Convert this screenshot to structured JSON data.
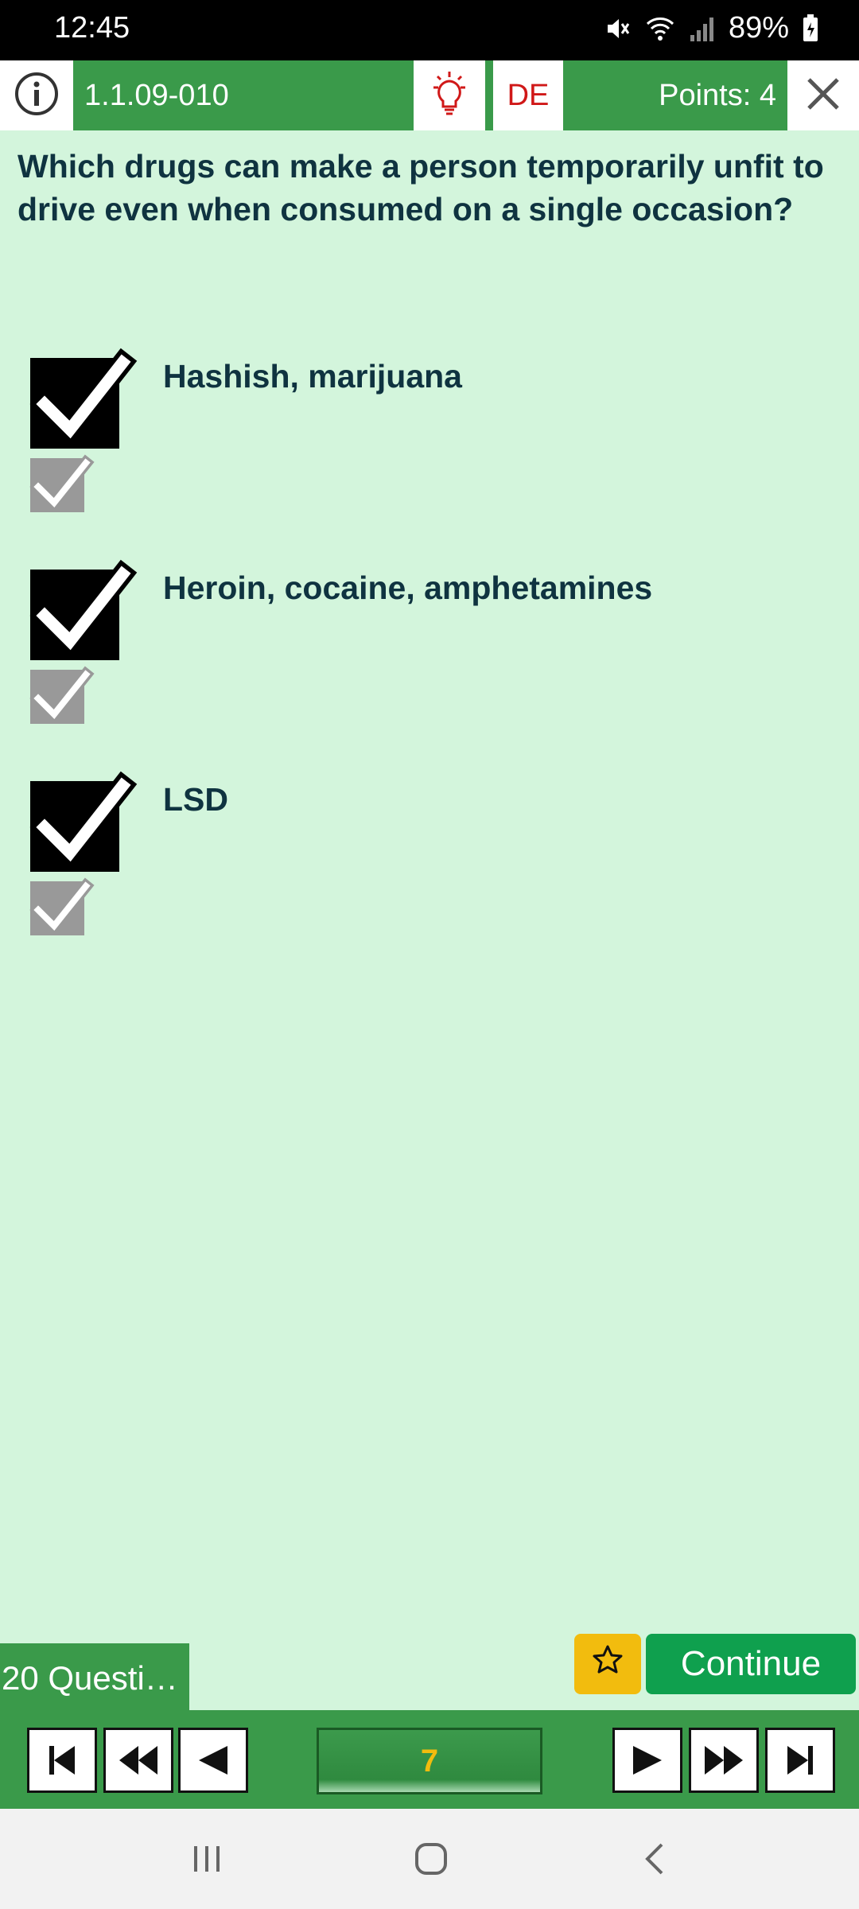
{
  "status_bar": {
    "time": "12:45",
    "battery": "89%",
    "icons": [
      "mute-icon",
      "wifi-icon",
      "signal-icon",
      "battery-charging-icon"
    ]
  },
  "header": {
    "question_id": "1.1.09-010",
    "language": "DE",
    "points": "Points: 4",
    "icons": [
      "info-icon",
      "lightbulb-icon",
      "close-icon"
    ]
  },
  "question": {
    "text": "Which drugs can make a person temporarily unfit to drive even when consumed on a single occasion?"
  },
  "answers": [
    {
      "label": "Hashish, marijuana",
      "checked": true,
      "solution_checked": true
    },
    {
      "label": "Heroin, cocaine, amphetamines",
      "checked": true,
      "solution_checked": true
    },
    {
      "label": "LSD",
      "checked": true,
      "solution_checked": true
    }
  ],
  "footer": {
    "questions_tab": "20 Questi…",
    "continue_label": "Continue",
    "star_icon": "star-icon"
  },
  "navigation": {
    "current_page": "7",
    "buttons": [
      "first-icon",
      "rewind-icon",
      "previous-icon",
      "next-icon",
      "fast-forward-icon",
      "last-icon"
    ]
  },
  "colors": {
    "primary_green": "#3a9a4a",
    "background": "#d3f5dc",
    "continue_green": "#0fa04e",
    "star_yellow": "#f2bc0e",
    "accent_red": "#d01818"
  }
}
